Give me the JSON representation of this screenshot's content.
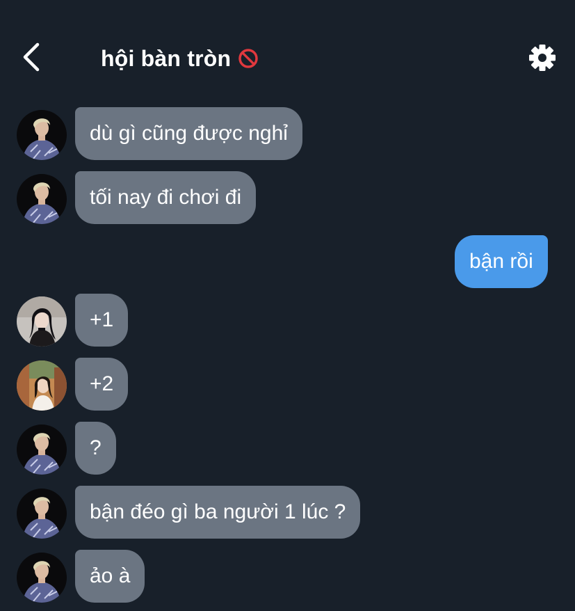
{
  "header": {
    "title": "hội bàn tròn",
    "back_icon": "chevron-left-icon",
    "status_icon": "prohibited-icon",
    "settings_icon": "gear-icon"
  },
  "colors": {
    "background": "#18202a",
    "incoming_bubble": "#6b7582",
    "outgoing_bubble": "#4a9aea",
    "text": "#ffffff",
    "prohibited_red": "#e0383e"
  },
  "messages": [
    {
      "sender": "blond-member",
      "direction": "incoming",
      "text": "dù gì cũng được nghỉ"
    },
    {
      "sender": "blond-member",
      "direction": "incoming",
      "text": "tối nay đi chơi đi"
    },
    {
      "sender": "me",
      "direction": "outgoing",
      "text": "bận rồi"
    },
    {
      "sender": "black-hair-member",
      "direction": "incoming",
      "text": "+1"
    },
    {
      "sender": "outdoor-member",
      "direction": "incoming",
      "text": "+2"
    },
    {
      "sender": "blond-member",
      "direction": "incoming",
      "text": "?"
    },
    {
      "sender": "blond-member",
      "direction": "incoming",
      "text": "bận đéo gì ba người 1 lúc ?"
    },
    {
      "sender": "blond-member",
      "direction": "incoming",
      "text": "ảo à"
    }
  ]
}
